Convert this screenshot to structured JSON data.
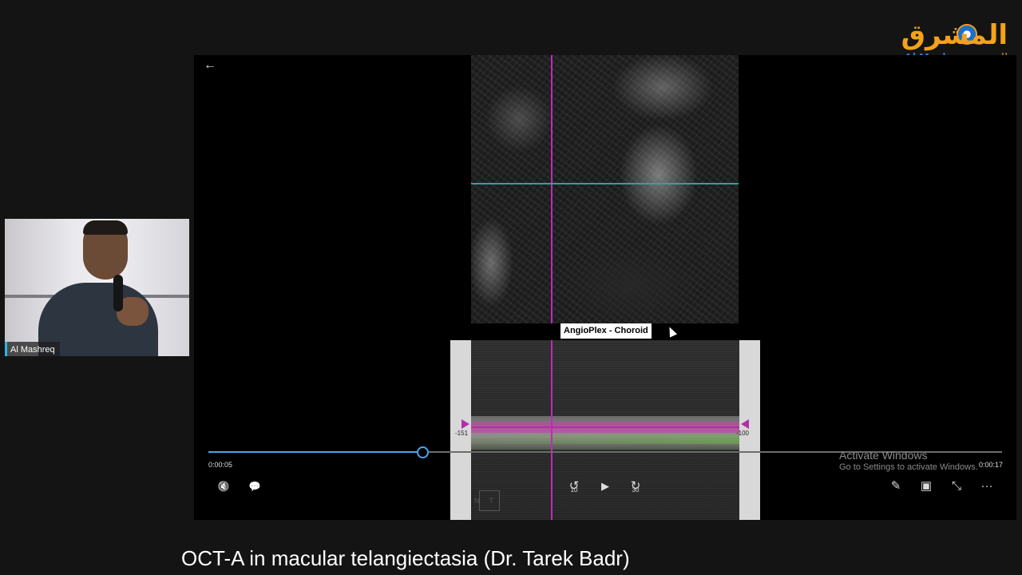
{
  "logo": {
    "arabic_name": "المشرق",
    "english_name": "Al Mashreq",
    "arabic_sub": "للعيون"
  },
  "player": {
    "back_icon": "←",
    "image_label": "AngioPlex - Choroid",
    "bscan": {
      "tick_left": "-151",
      "tick_right": "-100",
      "orientation_label": "NT"
    },
    "time_current": "0:00:05",
    "time_total": "0:00:17",
    "progress_fraction": 0.27,
    "controls": {
      "mute_icon": "🔇",
      "caption_icon": "💬",
      "rewind_icon": "↺",
      "rewind_seconds": "10",
      "play_icon": "▶",
      "forward_icon": "↻",
      "forward_seconds": "30",
      "edit_icon": "✎",
      "miniview_icon": "▣",
      "fullscreen_icon": "⤡",
      "more_icon": "···"
    },
    "accent_color": "#4da2e8"
  },
  "watermark": {
    "line1": "Activate Windows",
    "line2": "Go to Settings to activate Windows."
  },
  "webcam": {
    "name": "Al Mashreq"
  },
  "subtitle": "OCT-A in macular telangiectasia (Dr. Tarek Badr)"
}
